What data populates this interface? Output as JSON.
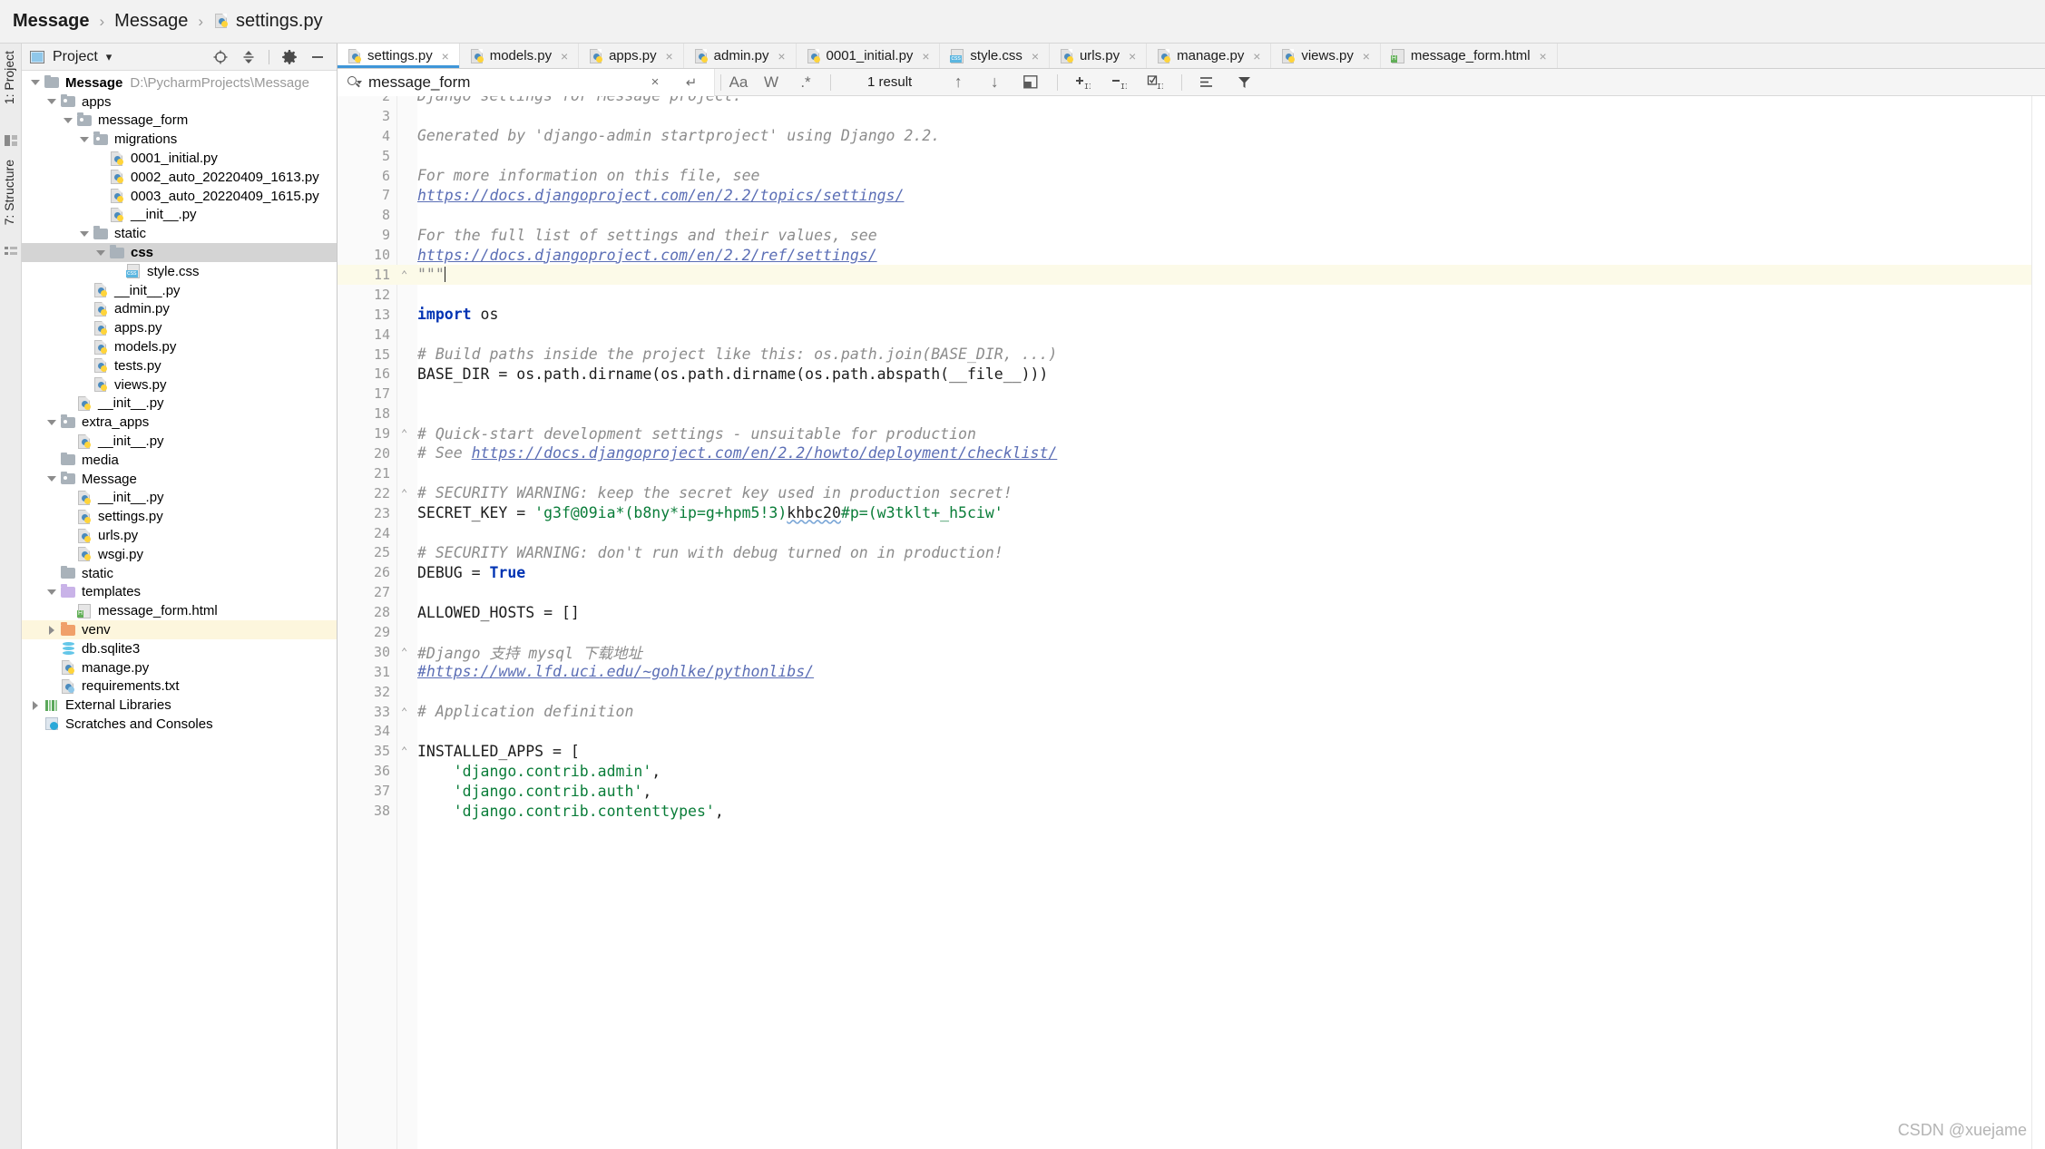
{
  "breadcrumb": {
    "items": [
      {
        "label": "Message",
        "bold": true,
        "icon": ""
      },
      {
        "label": "Message",
        "bold": false,
        "icon": ""
      },
      {
        "label": "settings.py",
        "bold": false,
        "icon": "python-file-icon"
      }
    ],
    "separator": "›"
  },
  "left_strip": {
    "project_label": "1: Project",
    "structure_label": "7: Structure"
  },
  "project_panel": {
    "title": "Project",
    "dropdown_caret": "▾",
    "icons": [
      "locate-icon",
      "collapse-all-icon",
      "settings-gear-icon",
      "hide-icon"
    ],
    "tree": [
      {
        "depth": 0,
        "arrow": "down",
        "icon": "folder-icon",
        "label": "Message",
        "bold": true,
        "path": "D:\\PycharmProjects\\Message",
        "state": "normal"
      },
      {
        "depth": 1,
        "arrow": "down",
        "icon": "module-folder-icon",
        "label": "apps",
        "state": "normal"
      },
      {
        "depth": 2,
        "arrow": "down",
        "icon": "module-folder-icon",
        "label": "message_form",
        "state": "normal"
      },
      {
        "depth": 3,
        "arrow": "down",
        "icon": "module-folder-icon",
        "label": "migrations",
        "state": "normal"
      },
      {
        "depth": 4,
        "arrow": "none",
        "icon": "python-file-icon",
        "label": "0001_initial.py",
        "state": "normal"
      },
      {
        "depth": 4,
        "arrow": "none",
        "icon": "python-file-icon",
        "label": "0002_auto_20220409_1613.py",
        "state": "normal"
      },
      {
        "depth": 4,
        "arrow": "none",
        "icon": "python-file-icon",
        "label": "0003_auto_20220409_1615.py",
        "state": "normal"
      },
      {
        "depth": 4,
        "arrow": "none",
        "icon": "python-file-icon",
        "label": "__init__.py",
        "state": "normal"
      },
      {
        "depth": 3,
        "arrow": "down",
        "icon": "folder-icon",
        "label": "static",
        "state": "normal"
      },
      {
        "depth": 4,
        "arrow": "down",
        "icon": "folder-icon",
        "label": "css",
        "bold": true,
        "state": "selected"
      },
      {
        "depth": 5,
        "arrow": "none",
        "icon": "css-file-icon",
        "label": "style.css",
        "state": "normal"
      },
      {
        "depth": 3,
        "arrow": "none",
        "icon": "python-file-icon",
        "label": "__init__.py",
        "state": "normal"
      },
      {
        "depth": 3,
        "arrow": "none",
        "icon": "python-file-icon",
        "label": "admin.py",
        "state": "normal"
      },
      {
        "depth": 3,
        "arrow": "none",
        "icon": "python-file-icon",
        "label": "apps.py",
        "state": "normal"
      },
      {
        "depth": 3,
        "arrow": "none",
        "icon": "python-file-icon",
        "label": "models.py",
        "state": "normal"
      },
      {
        "depth": 3,
        "arrow": "none",
        "icon": "python-file-icon",
        "label": "tests.py",
        "state": "normal"
      },
      {
        "depth": 3,
        "arrow": "none",
        "icon": "python-file-icon",
        "label": "views.py",
        "state": "normal"
      },
      {
        "depth": 2,
        "arrow": "none",
        "icon": "python-file-icon",
        "label": "__init__.py",
        "state": "normal"
      },
      {
        "depth": 1,
        "arrow": "down",
        "icon": "module-folder-icon",
        "label": "extra_apps",
        "state": "normal"
      },
      {
        "depth": 2,
        "arrow": "none",
        "icon": "python-file-icon",
        "label": "__init__.py",
        "state": "normal"
      },
      {
        "depth": 1,
        "arrow": "none",
        "icon": "folder-icon",
        "label": "media",
        "state": "normal"
      },
      {
        "depth": 1,
        "arrow": "down",
        "icon": "module-folder-icon",
        "label": "Message",
        "state": "normal"
      },
      {
        "depth": 2,
        "arrow": "none",
        "icon": "python-file-icon",
        "label": "__init__.py",
        "state": "normal"
      },
      {
        "depth": 2,
        "arrow": "none",
        "icon": "python-file-icon",
        "label": "settings.py",
        "state": "normal"
      },
      {
        "depth": 2,
        "arrow": "none",
        "icon": "python-file-icon",
        "label": "urls.py",
        "state": "normal"
      },
      {
        "depth": 2,
        "arrow": "none",
        "icon": "python-file-icon",
        "label": "wsgi.py",
        "state": "normal"
      },
      {
        "depth": 1,
        "arrow": "none",
        "icon": "folder-icon",
        "label": "static",
        "state": "normal"
      },
      {
        "depth": 1,
        "arrow": "down",
        "icon": "templates-folder-icon",
        "label": "templates",
        "state": "normal"
      },
      {
        "depth": 2,
        "arrow": "none",
        "icon": "html-file-icon",
        "label": "message_form.html",
        "state": "normal"
      },
      {
        "depth": 1,
        "arrow": "right",
        "icon": "venv-folder-icon",
        "label": "venv",
        "state": "highlight"
      },
      {
        "depth": 1,
        "arrow": "none",
        "icon": "sqlite-db-icon",
        "label": "db.sqlite3",
        "state": "normal"
      },
      {
        "depth": 1,
        "arrow": "none",
        "icon": "python-file-icon",
        "label": "manage.py",
        "state": "normal"
      },
      {
        "depth": 1,
        "arrow": "none",
        "icon": "config-file-icon",
        "label": "requirements.txt",
        "state": "normal"
      },
      {
        "depth": 0,
        "arrow": "right",
        "icon": "external-libraries-icon",
        "label": "External Libraries",
        "state": "normal"
      },
      {
        "depth": 0,
        "arrow": "none",
        "icon": "scratches-icon",
        "label": "Scratches and Consoles",
        "state": "normal"
      }
    ]
  },
  "editor": {
    "tabs": [
      {
        "label": "settings.py",
        "icon": "python-file-icon",
        "active": true,
        "close": "×"
      },
      {
        "label": "models.py",
        "icon": "python-file-icon",
        "active": false,
        "close": "×"
      },
      {
        "label": "apps.py",
        "icon": "python-file-icon",
        "active": false,
        "close": "×"
      },
      {
        "label": "admin.py",
        "icon": "python-file-icon",
        "active": false,
        "close": "×"
      },
      {
        "label": "0001_initial.py",
        "icon": "python-file-icon",
        "active": false,
        "close": "×"
      },
      {
        "label": "style.css",
        "icon": "css-file-icon",
        "active": false,
        "close": "×"
      },
      {
        "label": "urls.py",
        "icon": "python-file-icon",
        "active": false,
        "close": "×"
      },
      {
        "label": "manage.py",
        "icon": "python-file-icon",
        "active": false,
        "close": "×"
      },
      {
        "label": "views.py",
        "icon": "python-file-icon",
        "active": false,
        "close": "×"
      },
      {
        "label": "message_form.html",
        "icon": "html-file-icon",
        "active": false,
        "close": "×"
      }
    ],
    "find_bar": {
      "query": "message_form",
      "placeholder": "Search",
      "clear_label": "×",
      "history_label": "↵",
      "match_case_label": "Aa",
      "words_label": "W",
      "regex_label": ".*",
      "result_count": "1 result",
      "prev_label": "↑",
      "next_label": "↓",
      "select_all_label": "❐",
      "add_line_label": "+",
      "remove_line_label": "−",
      "toggle_label": "☑",
      "filter_scope_label": "☰",
      "filter_label": "▼"
    },
    "code_lines": [
      {
        "num": "2",
        "fold": "",
        "current": false,
        "tokens": [
          {
            "t": "doc",
            "s": "Django settings for Message project."
          }
        ],
        "clip_top": true
      },
      {
        "num": "3",
        "fold": "",
        "current": false,
        "tokens": []
      },
      {
        "num": "4",
        "fold": "",
        "current": false,
        "tokens": [
          {
            "t": "doc",
            "s": "Generated by 'django-admin startproject' using Django 2.2."
          }
        ]
      },
      {
        "num": "5",
        "fold": "",
        "current": false,
        "tokens": []
      },
      {
        "num": "6",
        "fold": "",
        "current": false,
        "tokens": [
          {
            "t": "doc",
            "s": "For more information on this file, see"
          }
        ]
      },
      {
        "num": "7",
        "fold": "",
        "current": false,
        "tokens": [
          {
            "t": "link",
            "s": "https://docs.djangoproject.com/en/2.2/topics/settings/"
          }
        ]
      },
      {
        "num": "8",
        "fold": "",
        "current": false,
        "tokens": []
      },
      {
        "num": "9",
        "fold": "",
        "current": false,
        "tokens": [
          {
            "t": "doc",
            "s": "For the full list of settings and their values, see"
          }
        ]
      },
      {
        "num": "10",
        "fold": "",
        "current": false,
        "tokens": [
          {
            "t": "link",
            "s": "https://docs.djangoproject.com/en/2.2/ref/settings/"
          }
        ]
      },
      {
        "num": "11",
        "fold": "⌃",
        "current": true,
        "tokens": [
          {
            "t": "doc",
            "s": "\"\"\""
          }
        ],
        "caret": true
      },
      {
        "num": "12",
        "fold": "",
        "current": false,
        "tokens": []
      },
      {
        "num": "13",
        "fold": "",
        "current": false,
        "tokens": [
          {
            "t": "kw",
            "s": "import"
          },
          {
            "t": "plain",
            "s": " os"
          }
        ]
      },
      {
        "num": "14",
        "fold": "",
        "current": false,
        "tokens": []
      },
      {
        "num": "15",
        "fold": "",
        "current": false,
        "tokens": [
          {
            "t": "comment",
            "s": "# Build paths inside the project like this: os.path.join(BASE_DIR, ...)"
          }
        ]
      },
      {
        "num": "16",
        "fold": "",
        "current": false,
        "tokens": [
          {
            "t": "plain",
            "s": "BASE_DIR = os.path.dirname(os.path.dirname(os.path.abspath(__file__)))"
          }
        ]
      },
      {
        "num": "17",
        "fold": "",
        "current": false,
        "tokens": []
      },
      {
        "num": "18",
        "fold": "",
        "current": false,
        "tokens": []
      },
      {
        "num": "19",
        "fold": "⌃",
        "current": false,
        "tokens": [
          {
            "t": "comment",
            "s": "# Quick-start development settings - unsuitable for production"
          }
        ]
      },
      {
        "num": "20",
        "fold": "",
        "current": false,
        "tokens": [
          {
            "t": "comment",
            "s": "# See "
          },
          {
            "t": "link",
            "s": "https://docs.djangoproject.com/en/2.2/howto/deployment/checklist/"
          }
        ]
      },
      {
        "num": "21",
        "fold": "",
        "current": false,
        "tokens": []
      },
      {
        "num": "22",
        "fold": "⌃",
        "current": false,
        "tokens": [
          {
            "t": "comment",
            "s": "# SECURITY WARNING: keep the secret key used in production secret!"
          }
        ]
      },
      {
        "num": "23",
        "fold": "",
        "current": false,
        "tokens": [
          {
            "t": "plain",
            "s": "SECRET_KEY = "
          },
          {
            "t": "str",
            "s": "'g3f@09ia*(b8ny*ip=g+hpm5!3)"
          },
          {
            "t": "strtypo",
            "s": "khbc20"
          },
          {
            "t": "str",
            "s": "#p=(w3tklt+_h5ciw'"
          }
        ]
      },
      {
        "num": "24",
        "fold": "",
        "current": false,
        "tokens": []
      },
      {
        "num": "25",
        "fold": "",
        "current": false,
        "tokens": [
          {
            "t": "comment",
            "s": "# SECURITY WARNING: don't run with debug turned on in production!"
          }
        ]
      },
      {
        "num": "26",
        "fold": "",
        "current": false,
        "tokens": [
          {
            "t": "plain",
            "s": "DEBUG = "
          },
          {
            "t": "kw",
            "s": "True"
          }
        ]
      },
      {
        "num": "27",
        "fold": "",
        "current": false,
        "tokens": []
      },
      {
        "num": "28",
        "fold": "",
        "current": false,
        "tokens": [
          {
            "t": "plain",
            "s": "ALLOWED_HOSTS = []"
          }
        ]
      },
      {
        "num": "29",
        "fold": "",
        "current": false,
        "tokens": []
      },
      {
        "num": "30",
        "fold": "⌃",
        "current": false,
        "tokens": [
          {
            "t": "comment",
            "s": "#Django 支持 mysql 下载地址"
          }
        ]
      },
      {
        "num": "31",
        "fold": "",
        "current": false,
        "tokens": [
          {
            "t": "link",
            "s": "#https://www.lfd.uci.edu/~gohlke/pythonlibs/"
          }
        ]
      },
      {
        "num": "32",
        "fold": "",
        "current": false,
        "tokens": []
      },
      {
        "num": "33",
        "fold": "⌃",
        "current": false,
        "tokens": [
          {
            "t": "comment",
            "s": "# Application definition"
          }
        ]
      },
      {
        "num": "34",
        "fold": "",
        "current": false,
        "tokens": []
      },
      {
        "num": "35",
        "fold": "⌃",
        "current": false,
        "tokens": [
          {
            "t": "plain",
            "s": "INSTALLED_APPS = ["
          }
        ]
      },
      {
        "num": "36",
        "fold": "",
        "current": false,
        "tokens": [
          {
            "t": "str",
            "s": "    'django.contrib.admin'"
          },
          {
            "t": "plain",
            "s": ","
          }
        ]
      },
      {
        "num": "37",
        "fold": "",
        "current": false,
        "tokens": [
          {
            "t": "str",
            "s": "    'django.contrib.auth'"
          },
          {
            "t": "plain",
            "s": ","
          }
        ]
      },
      {
        "num": "38",
        "fold": "",
        "current": false,
        "tokens": [
          {
            "t": "str",
            "s": "    'django.contrib.contenttypes'"
          },
          {
            "t": "plain",
            "s": ","
          }
        ],
        "clip_bottom": true
      }
    ]
  },
  "watermark": "CSDN @xuejame"
}
